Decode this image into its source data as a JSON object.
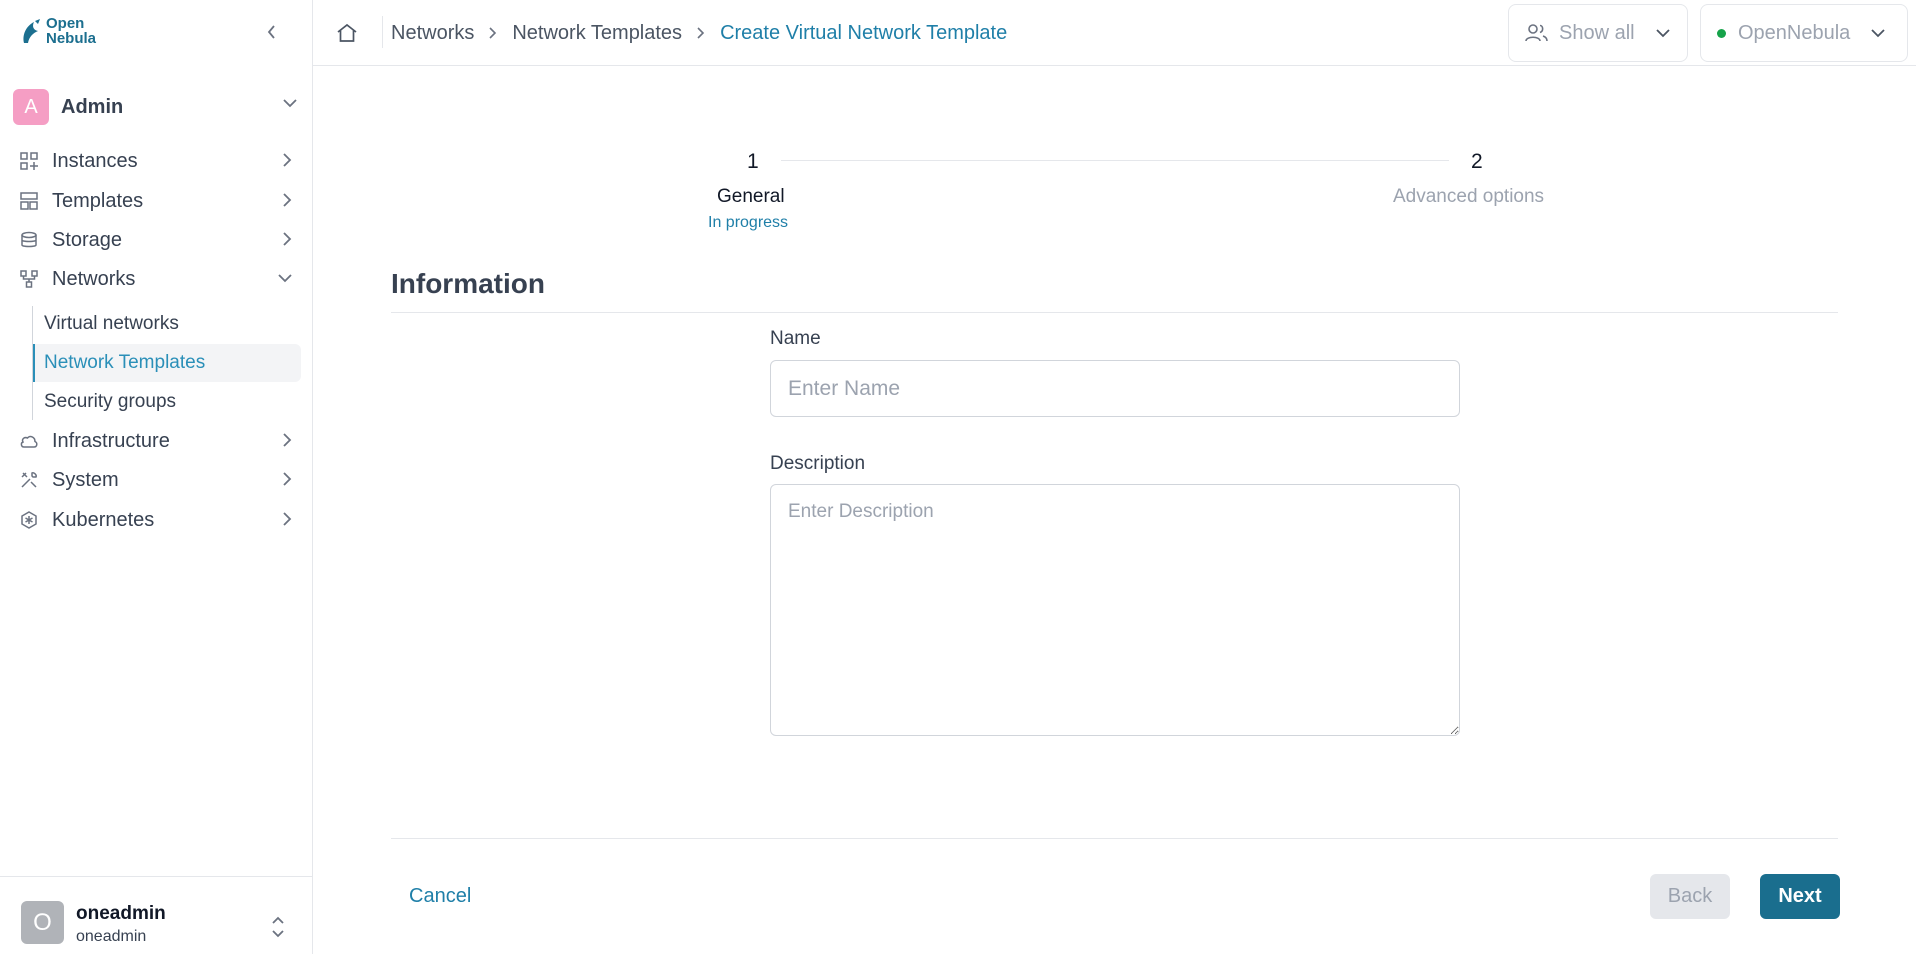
{
  "brand": {
    "logo_line1": "Open",
    "logo_line2": "Nebula"
  },
  "sidebar": {
    "group": {
      "avatar_letter": "A",
      "label": "Admin"
    },
    "items": [
      {
        "label": "Instances",
        "icon": "grid-plus-icon"
      },
      {
        "label": "Templates",
        "icon": "layout-icon"
      },
      {
        "label": "Storage",
        "icon": "database-icon"
      },
      {
        "label": "Networks",
        "icon": "network-icon"
      },
      {
        "label": "Infrastructure",
        "icon": "cloud-icon"
      },
      {
        "label": "System",
        "icon": "tools-icon"
      },
      {
        "label": "Kubernetes",
        "icon": "helm-icon"
      }
    ],
    "subitems": [
      {
        "label": "Virtual networks"
      },
      {
        "label": "Network Templates"
      },
      {
        "label": "Security groups"
      }
    ],
    "user": {
      "avatar_letter": "O",
      "name": "oneadmin",
      "group": "oneadmin"
    }
  },
  "breadcrumb": [
    "Networks",
    "Network Templates",
    "Create Virtual Network Template"
  ],
  "topbar": {
    "filter_label": "Show all",
    "zone_label": "OpenNebula",
    "zone_status_color": "#16a34a"
  },
  "stepper": {
    "steps": [
      {
        "number": "1",
        "label": "General",
        "status": "In progress"
      },
      {
        "number": "2",
        "label": "Advanced options",
        "status": ""
      }
    ]
  },
  "form": {
    "section_title": "Information",
    "name_label": "Name",
    "name_placeholder": "Enter Name",
    "name_value": "",
    "description_label": "Description",
    "description_placeholder": "Enter Description",
    "description_value": ""
  },
  "actions": {
    "cancel": "Cancel",
    "back": "Back",
    "next": "Next"
  },
  "colors": {
    "accent": "#1f7fa8",
    "primary_button": "#1a6e8e",
    "admin_avatar": "#f59ec4"
  }
}
